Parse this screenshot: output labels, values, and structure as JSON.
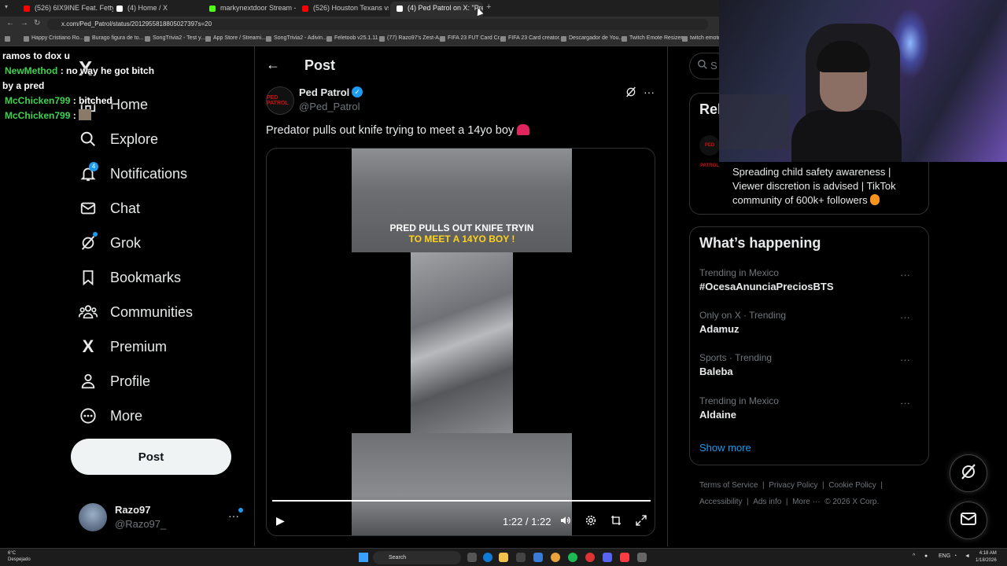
{
  "browser": {
    "tabs": [
      {
        "title": "(526) 6IX9INE Feat. Fetty Wap",
        "color": "#ff0000"
      },
      {
        "title": "(4) Home / X",
        "color": "#ffffff"
      },
      {
        "title": "markynextdoor Stream - Watch",
        "color": "#53fc18"
      },
      {
        "title": "(526) Houston Texans vs New E",
        "color": "#ff0000"
      },
      {
        "title": "(4) Ped Patrol on X: \"Predator p",
        "color": "#ffffff"
      }
    ],
    "new_tab": "+",
    "url": "x.com/Ped_Patrol/status/2012955818805027397s=20",
    "bookmarks": [
      "Happy Cristiano Ro...",
      "Burago figura de to...",
      "SongTrivia2 - Test y...",
      "App Store / Streami...",
      "SongTrivia2 - Adivin...",
      "Feletoob v25.1.11",
      "(77) Razo97's Zest-A...",
      "FIFA 23 FUT Card Cr...",
      "FIFA 23 Card creator...",
      "Descargador de You...",
      "Twitch Emote Resizer",
      "twitch emote re"
    ]
  },
  "chat": [
    {
      "user": "",
      "text": "ramos to dox u"
    },
    {
      "user": "NewMethod",
      "text": ": no way he got bitch"
    },
    {
      "user": "",
      "text": "by a pred"
    },
    {
      "user": "McChicken799",
      "text": ": bitched"
    },
    {
      "user": "McChicken799",
      "text": ":"
    }
  ],
  "nav": {
    "logo": "X",
    "items": [
      {
        "label": "Home",
        "icon": "home-icon"
      },
      {
        "label": "Explore",
        "icon": "search-icon"
      },
      {
        "label": "Notifications",
        "icon": "bell-icon",
        "badge": "4"
      },
      {
        "label": "Chat",
        "icon": "mail-icon"
      },
      {
        "label": "Grok",
        "icon": "grok-icon"
      },
      {
        "label": "Bookmarks",
        "icon": "bookmark-icon"
      },
      {
        "label": "Communities",
        "icon": "people-icon"
      },
      {
        "label": "Premium",
        "icon": "x-icon"
      },
      {
        "label": "Profile",
        "icon": "person-icon"
      },
      {
        "label": "More",
        "icon": "more-circle-icon"
      }
    ],
    "post_button": "Post",
    "account": {
      "name": "Razo97",
      "handle": "@Razo97_",
      "more": "···"
    }
  },
  "main": {
    "back": "←",
    "title": "Post",
    "author": {
      "name": "Ped Patrol",
      "handle": "@Ped_Patrol",
      "avatar_text": "PED PATROL"
    },
    "text": "Predator pulls out knife trying to meet a 14yo boy",
    "video": {
      "caption_line1": "PRED PULLS OUT KNIFE TRYIN",
      "caption_line2": "TO MEET A 14YO BOY !",
      "time": "1:22 / 1:22",
      "progress": 1.0
    }
  },
  "right": {
    "search_placeholder": "S",
    "relevant_title": "Rel",
    "relevant_avatar_text": "PED PATROL",
    "relevant_bio": "Spreading child safety awareness | Viewer discretion is advised | TikTok community of 600k+ followers",
    "whats_happening_title": "What’s happening",
    "trends": [
      {
        "context": "Trending in Mexico",
        "name": "#OcesaAnunciaPreciosBTS"
      },
      {
        "context": "Only on X · Trending",
        "name": "Adamuz"
      },
      {
        "context": "Sports · Trending",
        "name": "Baleba"
      },
      {
        "context": "Trending in Mexico",
        "name": "Aldaine"
      }
    ],
    "trend_more": "···",
    "show_more": "Show more",
    "footer_line1": [
      "Terms of Service",
      "|",
      "Privacy Policy",
      "|",
      "Cookie Policy",
      "|"
    ],
    "footer_line2": [
      "Accessibility",
      "|",
      "Ads info",
      "|",
      "More ···",
      "© 2026 X Corp."
    ]
  },
  "taskbar": {
    "weather_temp": "6°C",
    "weather_desc": "Despejado",
    "search": "Search",
    "lang": "ENG",
    "time": "4:18 AM",
    "date": "1/18/2026"
  },
  "colors": {
    "accent": "#1d9bf0",
    "chat_user": "#3ed34f",
    "caption_yellow": "#ffd21c"
  }
}
